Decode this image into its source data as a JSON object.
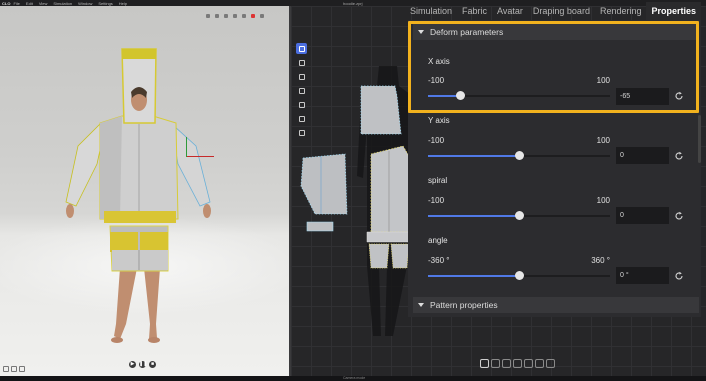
{
  "menu": {
    "items": [
      "File",
      "Edit",
      "View",
      "Simulation",
      "Window",
      "Settings",
      "Help"
    ],
    "file_title": "hoodie.zprj"
  },
  "tabs": [
    "Simulation",
    "Fabric",
    "Avatar",
    "Draping board",
    "Rendering",
    "Properties"
  ],
  "active_tab": "Properties",
  "deform": {
    "header": "Deform parameters",
    "params": [
      {
        "label": "X axis",
        "min": "-100",
        "max": "100",
        "value": "-65",
        "position": 0.175
      },
      {
        "label": "Y axis",
        "min": "-100",
        "max": "100",
        "value": "0",
        "position": 0.5
      },
      {
        "label": "spiral",
        "min": "-100",
        "max": "100",
        "value": "0",
        "position": 0.5
      },
      {
        "label": "angle",
        "min": "-360 °",
        "max": "360 °",
        "value": "0 °",
        "position": 0.5
      }
    ]
  },
  "pattern": {
    "header": "Pattern properties"
  },
  "status": {
    "text": "Camera mode"
  },
  "colors": {
    "highlight": "#f2b21e",
    "slider_fill": "#5079e6",
    "active_tool": "#4b6ee0",
    "panel_bg": "#2c2c2f"
  },
  "icons": {
    "reset": "refresh-icon",
    "collapse": "triangle-down-icon",
    "tools": [
      "select-pattern-icon",
      "curve-icon",
      "rectangle-icon",
      "list-icon",
      "note-icon",
      "book-icon",
      "tag-icon"
    ]
  }
}
